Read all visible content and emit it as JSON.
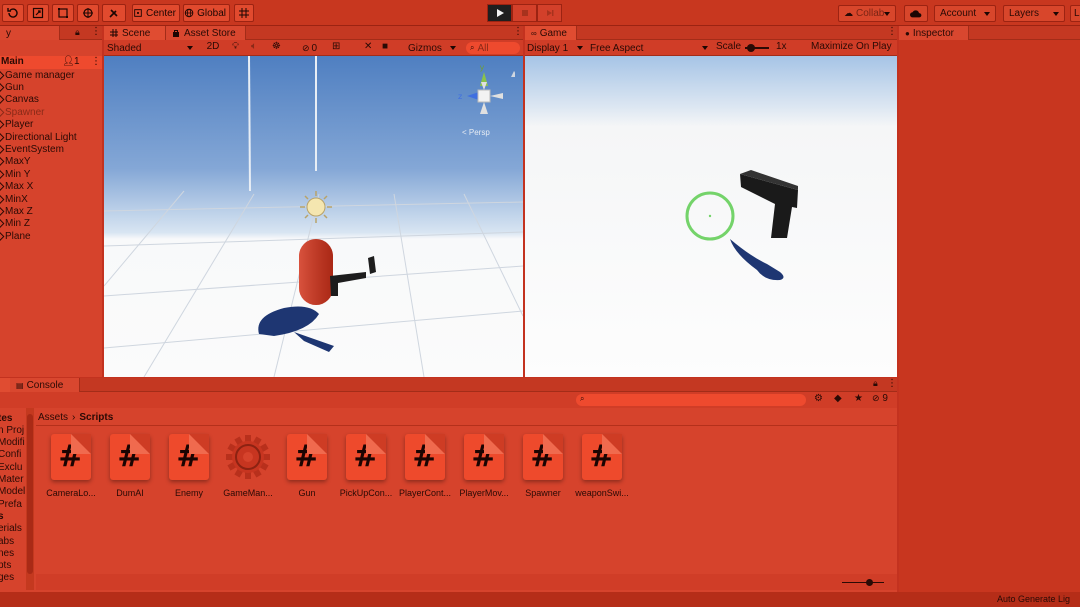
{
  "toolbar": {
    "center_label": "Center",
    "global_label": "Global",
    "collab_label": "Collab",
    "account_label": "Account",
    "layers_label": "Layers",
    "layout_label": "L"
  },
  "hierarchy": {
    "tab_label": "y",
    "scene_name": "Main",
    "badge_count": "1",
    "items": [
      {
        "label": "Game manager"
      },
      {
        "label": "Gun"
      },
      {
        "label": "Canvas"
      },
      {
        "label": "Spawner",
        "disabled": true
      },
      {
        "label": "Player"
      },
      {
        "label": "Directional Light"
      },
      {
        "label": "EventSystem"
      },
      {
        "label": "MaxY"
      },
      {
        "label": "Min Y"
      },
      {
        "label": "Max X"
      },
      {
        "label": "MinX"
      },
      {
        "label": "Max Z"
      },
      {
        "label": "Min Z"
      },
      {
        "label": "Plane"
      }
    ]
  },
  "scene": {
    "tab_label": "Scene",
    "asset_store_tab": "Asset Store",
    "shading_mode": "Shaded",
    "mode_2d": "2D",
    "hidden_count": "0",
    "gizmos_label": "Gizmos",
    "search_placeholder": "All",
    "persp_label": "< Persp"
  },
  "game": {
    "tab_label": "Game",
    "display": "Display 1",
    "aspect": "Free Aspect",
    "scale_label": "Scale",
    "scale_value": "1x",
    "maximize_label": "Maximize On Play"
  },
  "inspector": {
    "tab_label": "Inspector"
  },
  "project": {
    "console_tab": "Console",
    "breadcrumb_root": "Assets",
    "breadcrumb_current": "Scripts",
    "hidden_packages": "9",
    "tree_items": [
      "tes",
      "n Proj",
      "Modifi",
      "Confi",
      "Exclu",
      "Mater",
      "Model",
      "Prefa",
      "s",
      "erials",
      "abs",
      "nes",
      "pts",
      "ges"
    ],
    "assets": [
      {
        "name": "CameraLo...",
        "type": "script"
      },
      {
        "name": "DumAI",
        "type": "script"
      },
      {
        "name": "Enemy",
        "type": "script"
      },
      {
        "name": "GameMan...",
        "type": "gear"
      },
      {
        "name": "Gun",
        "type": "script"
      },
      {
        "name": "PickUpCon...",
        "type": "script"
      },
      {
        "name": "PlayerCont...",
        "type": "script"
      },
      {
        "name": "PlayerMov...",
        "type": "script"
      },
      {
        "name": "Spawner",
        "type": "script"
      },
      {
        "name": "weaponSwi...",
        "type": "script"
      }
    ]
  },
  "status_bar": {
    "text": "Auto Generate Lig"
  }
}
